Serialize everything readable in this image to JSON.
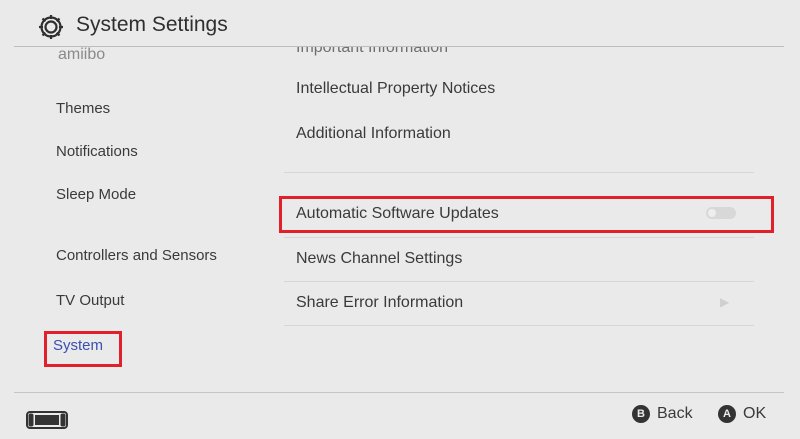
{
  "header": {
    "title": "System Settings",
    "icon": "gear-icon"
  },
  "sidebar": {
    "partial_item": "amiibo",
    "items": [
      {
        "label": "Themes"
      },
      {
        "label": "Notifications"
      },
      {
        "label": "Sleep Mode"
      },
      {
        "label": "Controllers and Sensors"
      },
      {
        "label": "TV Output"
      },
      {
        "label": "System",
        "active": true
      }
    ]
  },
  "content": {
    "partial_item": "Important Information",
    "items": [
      {
        "label": "Intellectual Property Notices"
      },
      {
        "label": "Additional Information"
      },
      {
        "label": "Automatic Software Updates",
        "highlighted": true
      },
      {
        "label": "News Channel Settings"
      },
      {
        "label": "Share Error Information"
      }
    ]
  },
  "footer": {
    "back_key": "B",
    "back_label": "Back",
    "ok_key": "A",
    "ok_label": "OK",
    "console_icon": "console-icon"
  },
  "colors": {
    "background": "#eaeaea",
    "active_text": "#3a4fb0",
    "highlight_box": "#e0202a",
    "text": "#3a3a3a"
  }
}
